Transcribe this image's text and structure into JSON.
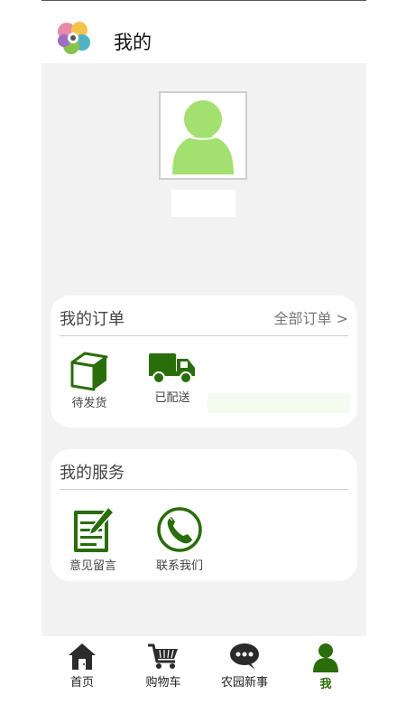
{
  "header": {
    "title": "我的"
  },
  "profile": {
    "avatar_color": "#a3e070"
  },
  "orders": {
    "title": "我的订单",
    "all_link": "全部订单 >",
    "items": [
      {
        "label": "待发货",
        "icon": "box-icon"
      },
      {
        "label": "已配送",
        "icon": "truck-icon"
      }
    ]
  },
  "services": {
    "title": "我的服务",
    "items": [
      {
        "label": "意见留言",
        "icon": "note-edit-icon"
      },
      {
        "label": "联系我们",
        "icon": "phone-icon"
      }
    ]
  },
  "tabbar": {
    "items": [
      {
        "label": "首页",
        "icon": "home-icon"
      },
      {
        "label": "购物车",
        "icon": "cart-icon"
      },
      {
        "label": "农园新事",
        "icon": "chat-bubble-icon"
      },
      {
        "label": "我",
        "icon": "user-icon",
        "active": true
      }
    ]
  },
  "colors": {
    "brand_green": "#2a6d0b",
    "background": "#f2f2f2"
  }
}
